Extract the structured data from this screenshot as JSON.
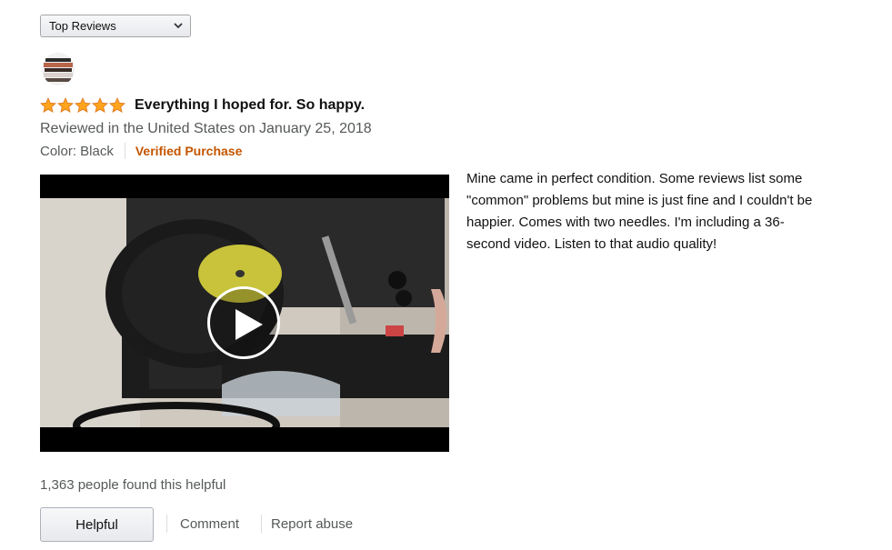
{
  "sort": {
    "selected": "Top Reviews"
  },
  "reviewer": {
    "name": ""
  },
  "review": {
    "rating": 5,
    "max_rating": 5,
    "title": "Everything I hoped for. So happy.",
    "date_text": "Reviewed in the United States on January 25, 2018",
    "color": "Color: Black",
    "verified": "Verified Purchase",
    "body": " Mine came in perfect condition. Some reviews list some \"common\" problems but mine is just fine and I couldn't be happier. Comes with two needles. I'm including a 36-second video. Listen to that audio quality!"
  },
  "helpful": {
    "count_text": "1,363 people found this helpful",
    "button_label": "Helpful",
    "comment_label": "Comment",
    "report_label": "Report abuse"
  },
  "colors": {
    "star": "#ffa41c",
    "verified": "#c45500",
    "secondary_text": "#565959"
  },
  "icons": {
    "sort_chevron": "chevron-down-icon",
    "video_play": "play-icon",
    "rating": "star-icon"
  }
}
